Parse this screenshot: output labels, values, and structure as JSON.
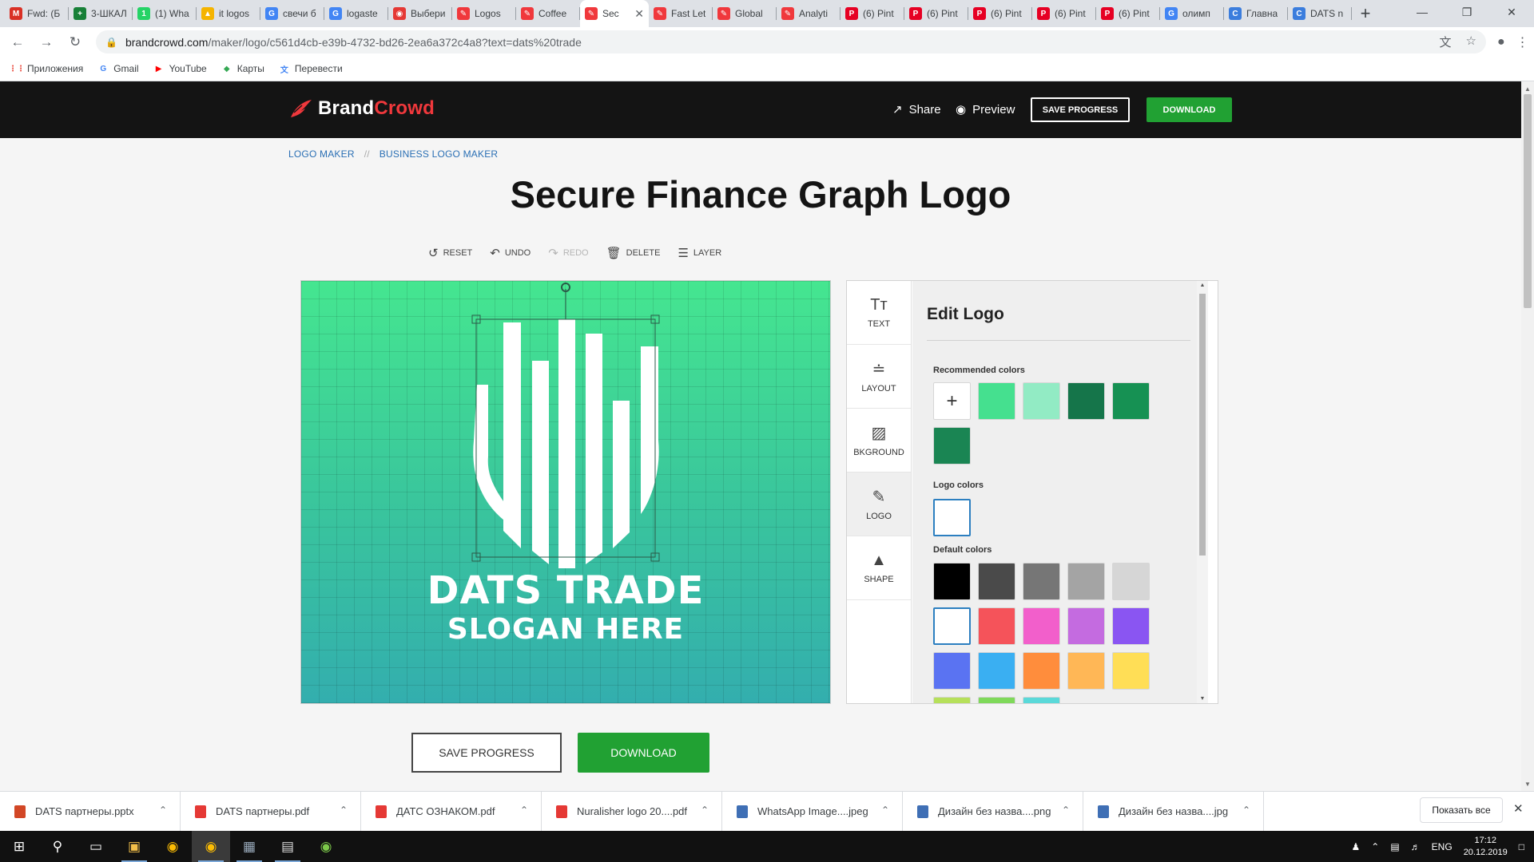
{
  "browser": {
    "tabs": [
      {
        "label": "Fwd: (Б",
        "icon": "gmail-icon",
        "color": "#d93025",
        "glyph": "M"
      },
      {
        "label": "3-ШКАЛ",
        "icon": "sheets-icon",
        "color": "#188038",
        "glyph": "+"
      },
      {
        "label": "(1) Wha",
        "icon": "whatsapp-icon",
        "color": "#25d366",
        "glyph": "1"
      },
      {
        "label": "it logos",
        "icon": "image-icon",
        "color": "#f5b400",
        "glyph": "▲"
      },
      {
        "label": "свечи б",
        "icon": "google-icon",
        "color": "#4285f4",
        "glyph": "G"
      },
      {
        "label": "logaste",
        "icon": "google-icon",
        "color": "#4285f4",
        "glyph": "G"
      },
      {
        "label": "Выбери",
        "icon": "logaster-icon",
        "color": "#e53935",
        "glyph": "◉"
      },
      {
        "label": "Logos",
        "icon": "brandcrowd-icon",
        "color": "#f0383c",
        "glyph": "✎"
      },
      {
        "label": "Coffee",
        "icon": "brandcrowd-icon",
        "color": "#f0383c",
        "glyph": "✎"
      },
      {
        "label": "Sec",
        "icon": "brandcrowd-icon",
        "color": "#f0383c",
        "glyph": "✎",
        "active": true
      },
      {
        "label": "Fast Let",
        "icon": "brandcrowd-icon",
        "color": "#f0383c",
        "glyph": "✎"
      },
      {
        "label": "Global",
        "icon": "brandcrowd-icon",
        "color": "#f0383c",
        "glyph": "✎"
      },
      {
        "label": "Analyti",
        "icon": "brandcrowd-icon",
        "color": "#f0383c",
        "glyph": "✎"
      },
      {
        "label": "(6) Pint",
        "icon": "pinterest-icon",
        "color": "#e60023",
        "glyph": "P"
      },
      {
        "label": "(6) Pint",
        "icon": "pinterest-icon",
        "color": "#e60023",
        "glyph": "P"
      },
      {
        "label": "(6) Pint",
        "icon": "pinterest-icon",
        "color": "#e60023",
        "glyph": "P"
      },
      {
        "label": "(6) Pint",
        "icon": "pinterest-icon",
        "color": "#e60023",
        "glyph": "P"
      },
      {
        "label": "(6) Pint",
        "icon": "pinterest-icon",
        "color": "#e60023",
        "glyph": "P"
      },
      {
        "label": "олимп",
        "icon": "google-icon",
        "color": "#4285f4",
        "glyph": "G"
      },
      {
        "label": "Главна",
        "icon": "site-icon",
        "color": "#3b7ddd",
        "glyph": "C"
      },
      {
        "label": "DATS n",
        "icon": "site-icon",
        "color": "#3b7ddd",
        "glyph": "C"
      }
    ],
    "url_host": "brandcrowd.com",
    "url_path": "/maker/logo/c561d4cb-e39b-4732-bd26-2ea6a372c4a8?text=dats%20trade",
    "bookmarks": [
      {
        "label": "Приложения",
        "icon": "apps-grid-icon",
        "color": "#ea4335",
        "glyph": "⋮⋮"
      },
      {
        "label": "Gmail",
        "icon": "google-icon",
        "color": "#4285f4",
        "glyph": "G"
      },
      {
        "label": "YouTube",
        "icon": "youtube-icon",
        "color": "#ff0000",
        "glyph": "▶"
      },
      {
        "label": "Карты",
        "icon": "maps-icon",
        "color": "#34a853",
        "glyph": "◆"
      },
      {
        "label": "Перевести",
        "icon": "translate-icon",
        "color": "#4285f4",
        "glyph": "文"
      }
    ]
  },
  "site": {
    "brand_part1": "Brand",
    "brand_part2": "Crowd",
    "header": {
      "share": "Share",
      "preview": "Preview",
      "save_progress": "SAVE PROGRESS",
      "download": "DOWNLOAD"
    },
    "breadcrumbs": [
      "LOGO MAKER",
      "//",
      "BUSINESS LOGO MAKER"
    ],
    "title": "Secure Finance Graph Logo",
    "actions": {
      "reset": "RESET",
      "undo": "UNDO",
      "redo": "REDO",
      "delete": "DELETE",
      "layer": "LAYER"
    },
    "logo": {
      "name": "DATS TRADE",
      "slogan": "SLOGAN HERE"
    },
    "side_tabs": [
      {
        "label": "TEXT",
        "icon": "text-icon",
        "glyph": "Tт"
      },
      {
        "label": "LAYOUT",
        "icon": "layout-icon",
        "glyph": "≐"
      },
      {
        "label": "BKGROUND",
        "icon": "background-icon",
        "glyph": "▨"
      },
      {
        "label": "LOGO",
        "icon": "logo-icon",
        "glyph": "✎",
        "active": true
      },
      {
        "label": "SHAPE",
        "icon": "shape-icon",
        "glyph": "▲"
      }
    ],
    "panel": {
      "title": "Edit Logo",
      "recommended_label": "Recommended colors",
      "recommended": [
        "#45e08f",
        "#92ebc4",
        "#15754a",
        "#169153",
        "#1a8553"
      ],
      "logo_colors_label": "Logo colors",
      "logo_colors": [
        "#ffffff"
      ],
      "default_label": "Default colors",
      "default": [
        "#000000",
        "#4a4a4a",
        "#767676",
        "#a4a4a4",
        "#d6d6d6",
        "#ffffff",
        "#f5535a",
        "#f25fcb",
        "#c46be0",
        "#8a55f2",
        "#5a73f2",
        "#3aaff2",
        "#ff8d3c",
        "#ffb756",
        "#ffde56",
        "#b6e05a",
        "#7fd95a",
        "#5ad9d9"
      ]
    },
    "bottom": {
      "save_progress": "SAVE PROGRESS",
      "download": "DOWNLOAD"
    }
  },
  "downloads": [
    {
      "name": "DATS партнеры.pptx",
      "icon": "pptx-file-icon",
      "color": "#d24726"
    },
    {
      "name": "DATS партнеры.pdf",
      "icon": "pdf-file-icon",
      "color": "#e53935"
    },
    {
      "name": "ДАТС ОЗНАКОМ.pdf",
      "icon": "pdf-file-icon",
      "color": "#e53935"
    },
    {
      "name": "Nuralisher logo 20....pdf",
      "icon": "pdf-file-icon",
      "color": "#e53935"
    },
    {
      "name": "WhatsApp Image....jpeg",
      "icon": "image-file-icon",
      "color": "#3f6fb5"
    },
    {
      "name": "Дизайн без назва....png",
      "icon": "image-file-icon",
      "color": "#3f6fb5"
    },
    {
      "name": "Дизайн без назва....jpg",
      "icon": "image-file-icon",
      "color": "#3f6fb5"
    }
  ],
  "show_all": "Показать все",
  "taskbar": {
    "lang": "ENG",
    "time": "17:12",
    "date": "20.12.2019"
  },
  "colors": {
    "accent_green": "#21a133",
    "brand_red": "#f0383c",
    "link_blue": "#2a6fb4"
  }
}
